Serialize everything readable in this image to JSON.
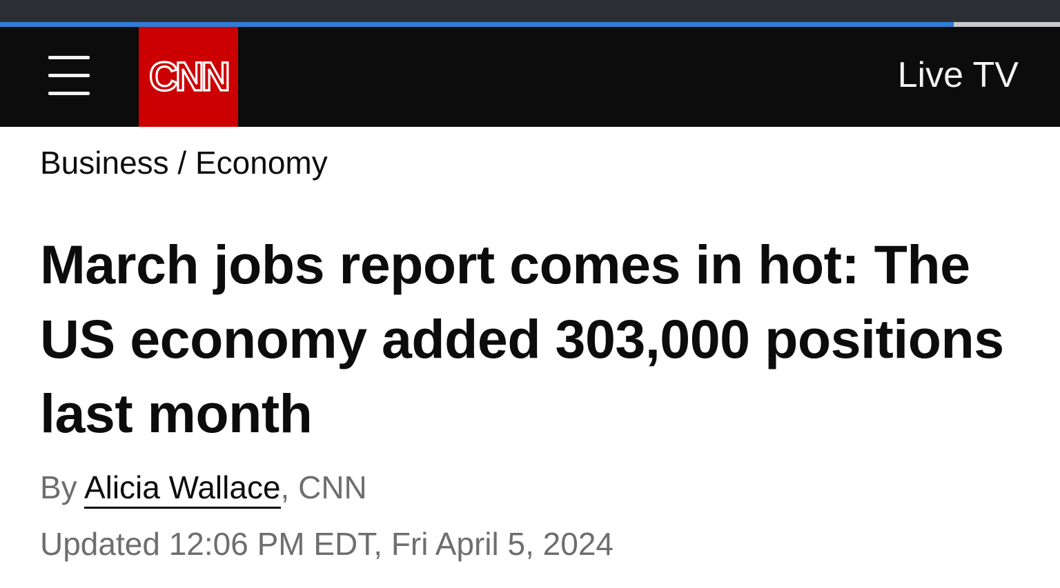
{
  "page": {
    "loading_progress": 0.9
  },
  "colors": {
    "header_bg": "#0c0c0c",
    "brand_red": "#cc0000",
    "progress_blue": "#2f7dd8",
    "text_primary": "#0c0c0c",
    "text_secondary": "#6e6e6e"
  },
  "header": {
    "menu_icon": "hamburger-menu-icon",
    "logo_text": "CNN",
    "live_tv_label": "Live TV"
  },
  "breadcrumb": {
    "section": "Business",
    "separator": " / ",
    "subsection": "Economy"
  },
  "article": {
    "headline": "March jobs report comes in hot: The US economy added 303,000 positions last month",
    "byline_prefix": "By ",
    "author": "Alicia Wallace",
    "byline_suffix": ", CNN",
    "updated": "Updated 12:06 PM EDT, Fri April 5, 2024"
  }
}
